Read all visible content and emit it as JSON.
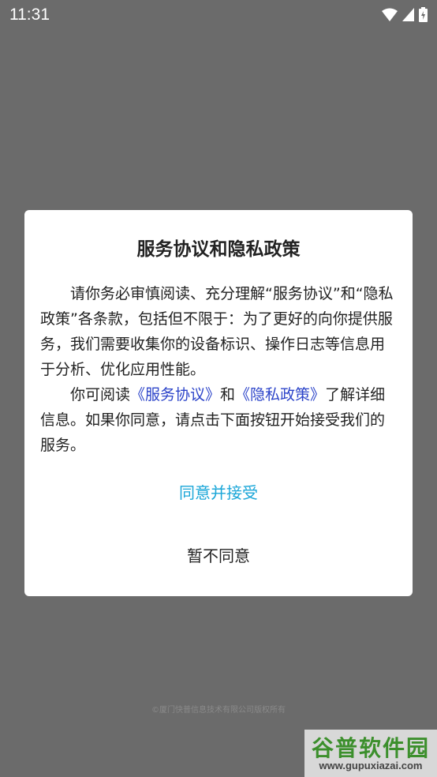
{
  "status_bar": {
    "time": "11:31",
    "icons": [
      "wifi-icon",
      "signal-icon",
      "battery-icon"
    ]
  },
  "dialog": {
    "title": "服务协议和隐私政策",
    "paragraph1": "请你务必审慎阅读、充分理解“服务协议”和“隐私政策”各条款，包括但不限于：为了更好的向你提供服务，我们需要收集你的设备标识、操作日志等信息用于分析、优化应用性能。",
    "paragraph2_prefix": "你可阅读",
    "service_link": "《服务协议》",
    "and_text": "和",
    "privacy_link": "《隐私政策》",
    "paragraph2_suffix": "了解详细信息。如果你同意，请点击下面按钮开始接受我们的服务。",
    "agree_label": "同意并接受",
    "decline_label": "暂不同意"
  },
  "footer": {
    "copyright": "©厦门快普信息技术有限公司版权所有"
  },
  "watermark": {
    "title": "谷普软件园",
    "url": "www.gupuxiazai.com"
  },
  "colors": {
    "overlay": "#6b6b6b",
    "link": "#2c44c9",
    "accent": "#1aa6d8"
  }
}
